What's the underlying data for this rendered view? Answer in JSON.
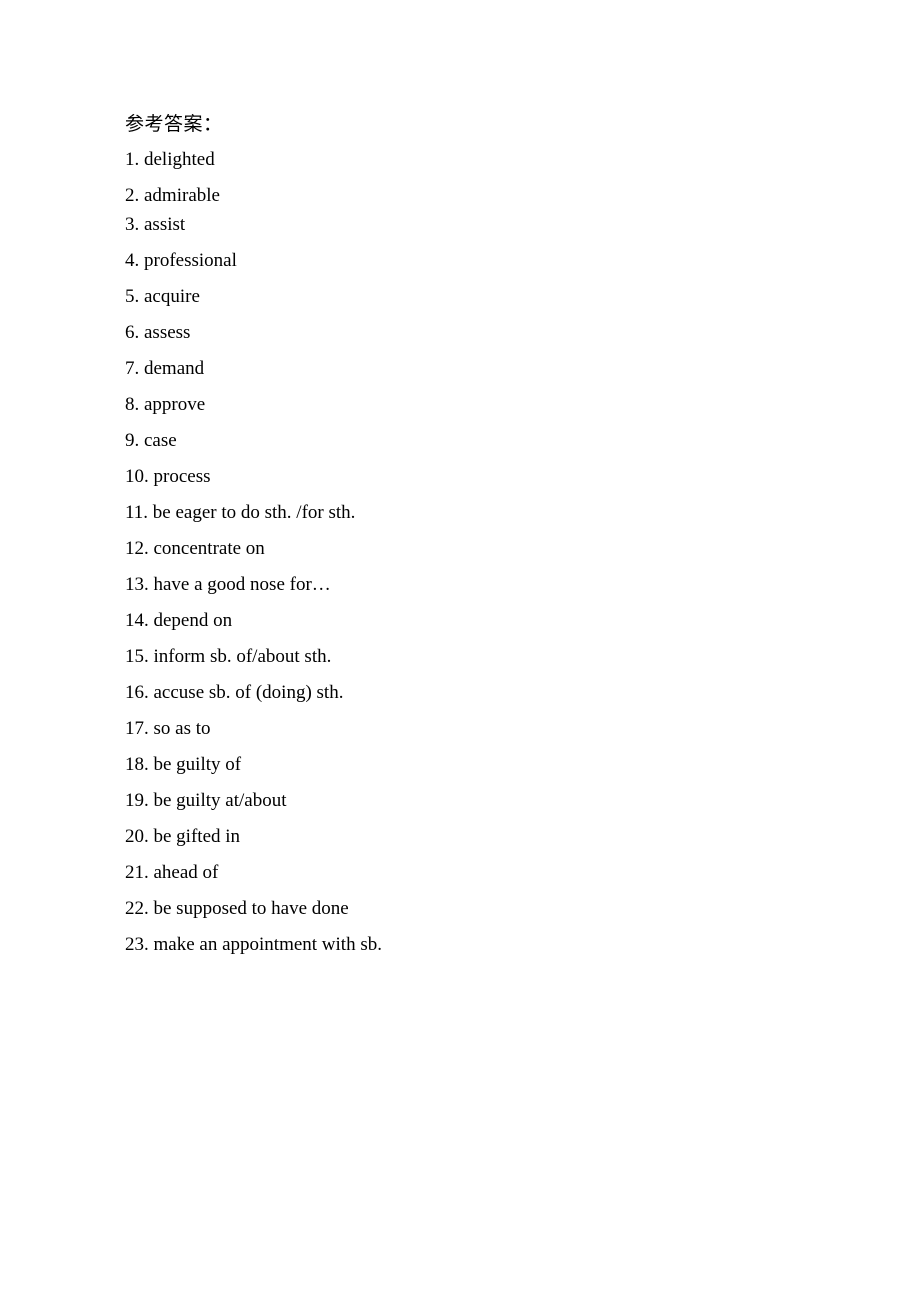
{
  "document": {
    "heading": "参考答案：",
    "answers": [
      {
        "text": "1. delighted",
        "spacing": "normal"
      },
      {
        "text": "2. admirable",
        "spacing": "tight"
      },
      {
        "text": "3. assist",
        "spacing": "normal"
      },
      {
        "text": "4. professional",
        "spacing": "normal"
      },
      {
        "text": "5. acquire",
        "spacing": "normal"
      },
      {
        "text": "6. assess",
        "spacing": "normal"
      },
      {
        "text": "7. demand",
        "spacing": "normal"
      },
      {
        "text": "8. approve",
        "spacing": "normal"
      },
      {
        "text": "9. case",
        "spacing": "normal"
      },
      {
        "text": "10. process",
        "spacing": "normal"
      },
      {
        "text": "11. be eager to do sth. /for sth.",
        "spacing": "normal"
      },
      {
        "text": "12. concentrate on",
        "spacing": "normal"
      },
      {
        "text": "13. have a good nose for…",
        "spacing": "normal"
      },
      {
        "text": "14. depend on",
        "spacing": "normal"
      },
      {
        "text": "15. inform sb. of/about sth.",
        "spacing": "normal"
      },
      {
        "text": "16. accuse sb. of (doing) sth.",
        "spacing": "normal"
      },
      {
        "text": "17. so as to",
        "spacing": "normal"
      },
      {
        "text": "18. be guilty of",
        "spacing": "normal"
      },
      {
        "text": "19. be guilty at/about",
        "spacing": "normal"
      },
      {
        "text": "20. be gifted in",
        "spacing": "normal"
      },
      {
        "text": "21. ahead of",
        "spacing": "normal"
      },
      {
        "text": "22. be supposed to have done",
        "spacing": "normal"
      },
      {
        "text": "23. make an appointment with sb.",
        "spacing": "normal"
      }
    ]
  }
}
